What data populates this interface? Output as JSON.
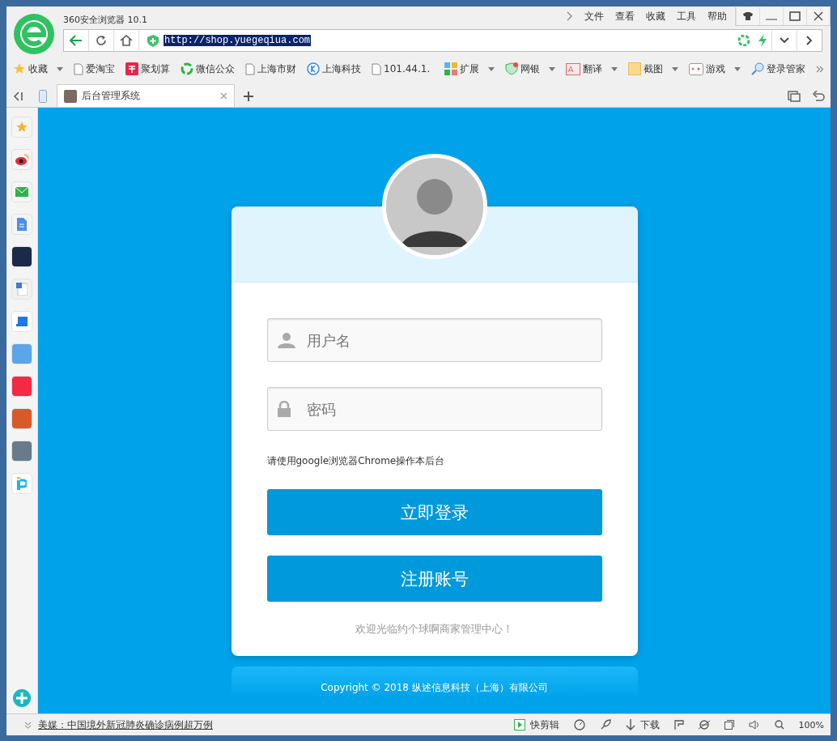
{
  "window": {
    "title": "360安全浏览器 10.1",
    "menu": [
      "文件",
      "查看",
      "收藏",
      "工具",
      "帮助"
    ]
  },
  "address_bar": {
    "url": "http://shop.yuegeqiua.com"
  },
  "bookmarks": [
    {
      "label": "收藏",
      "kind": "star"
    },
    {
      "label": "爱淘宝",
      "kind": "page"
    },
    {
      "label": "聚划算",
      "kind": "badge"
    },
    {
      "label": "微信公众",
      "kind": "ring"
    },
    {
      "label": "上海市财",
      "kind": "page"
    },
    {
      "label": "上海科技",
      "kind": "k"
    },
    {
      "label": "101.44.1.",
      "kind": "page"
    }
  ],
  "toolbar": [
    {
      "label": "扩展",
      "kind": "grid"
    },
    {
      "label": "网银",
      "kind": "shield"
    },
    {
      "label": "翻译",
      "kind": "translate"
    },
    {
      "label": "截图",
      "kind": "crop"
    },
    {
      "label": "游戏",
      "kind": "game"
    },
    {
      "label": "登录管家",
      "kind": "key"
    }
  ],
  "tabs": [
    {
      "title": "后台管理系统",
      "selected": true
    }
  ],
  "login": {
    "username": {
      "placeholder": "用户名"
    },
    "password": {
      "placeholder": "密码"
    },
    "note": "请使用google浏览器Chrome操作本后台",
    "buttons": [
      "立即登录",
      "注册账号"
    ],
    "welcome": "欢迎光临约个球啊商家管理中心！",
    "copyright": "Copyright © 2018 纵述信息科技（上海）有限公司"
  },
  "status_bar": {
    "news": "美媒：中国境外新冠肺炎确诊病例超万例",
    "items": [
      {
        "label": "快剪辑",
        "kind": "clip"
      },
      {
        "label": "下载",
        "kind": "download"
      }
    ],
    "zoom": "100%"
  }
}
